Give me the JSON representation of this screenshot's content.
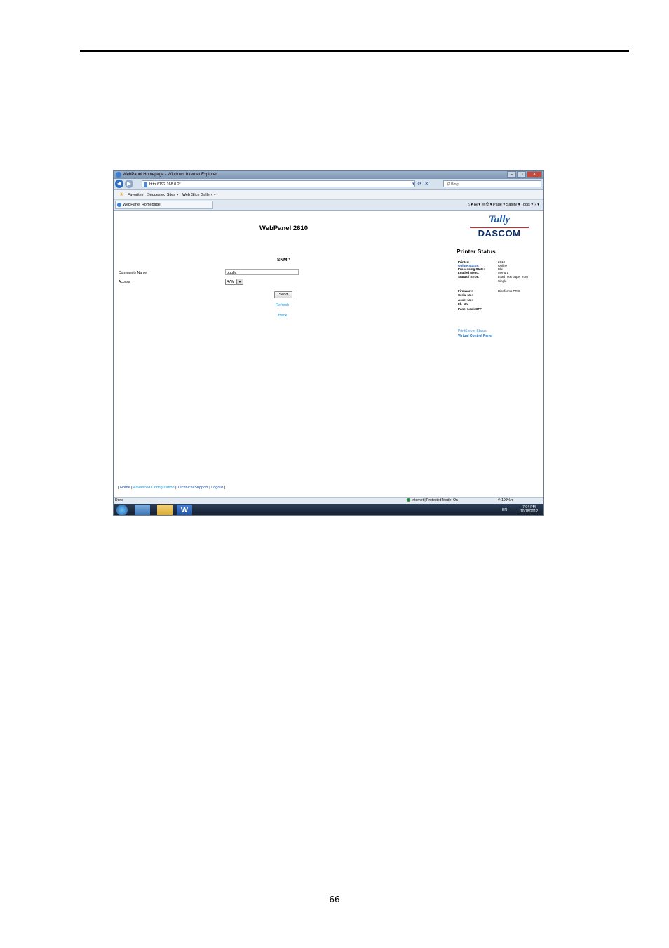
{
  "browser": {
    "window_title": "WebPanel Homepage - Windows Internet Explorer",
    "url": "http://192.168.0.2/",
    "search_placeholder": "Bing",
    "favorites_label": "Favorites",
    "suggested_sites": "Suggested Sites ▾",
    "web_slice": "Web Slice Gallery ▾",
    "tab_label": "WebPanel Homepage",
    "tools_menu": "Page ▾   Safety ▾   Tools ▾",
    "status_done": "Done",
    "status_zone": "Internet | Protected Mode: On",
    "zoom": "100%"
  },
  "webpanel": {
    "title": "WebPanel 2610",
    "section": "SNMP",
    "community_label": "Community Name",
    "community_value": "public",
    "access_label": "Access",
    "access_value": "R/W",
    "send_label": "Send",
    "refresh_label": "Refresh",
    "back_label": "Back"
  },
  "logo": {
    "tally": "Tally",
    "dascom": "DASCOM"
  },
  "status_panel": {
    "title": "Printer Status",
    "printer_label": "Printer:",
    "printer_value": "2610",
    "online_label": "Online Status:",
    "online_value": "Online",
    "processing_label": "Processing State:",
    "processing_value": "Idle",
    "menu_label": "Loaded Menu:",
    "menu_value": "Menu 1",
    "error_label": "Status / Error:",
    "error_value_1": "Load next paper from",
    "error_value_2": "Single",
    "firmware_label": "Firmware:",
    "firmware_value": "Dipsforms PRG",
    "serial_label": "Serial No:",
    "asset_label": "Asset No:",
    "fb_label": "Fb. No:",
    "panel_lock_label": "Panel Lock OFF",
    "link_status": "PrintServer Status",
    "link_vcp": "Virtual Control Panel"
  },
  "footer": {
    "home": "Home",
    "advanced": "Advanced Configuration",
    "support": "Technical Support",
    "logout": "Logout"
  },
  "taskbar": {
    "lang": "EN",
    "time": "7:04 PM",
    "date": "10/18/2012"
  },
  "page_number": "66"
}
